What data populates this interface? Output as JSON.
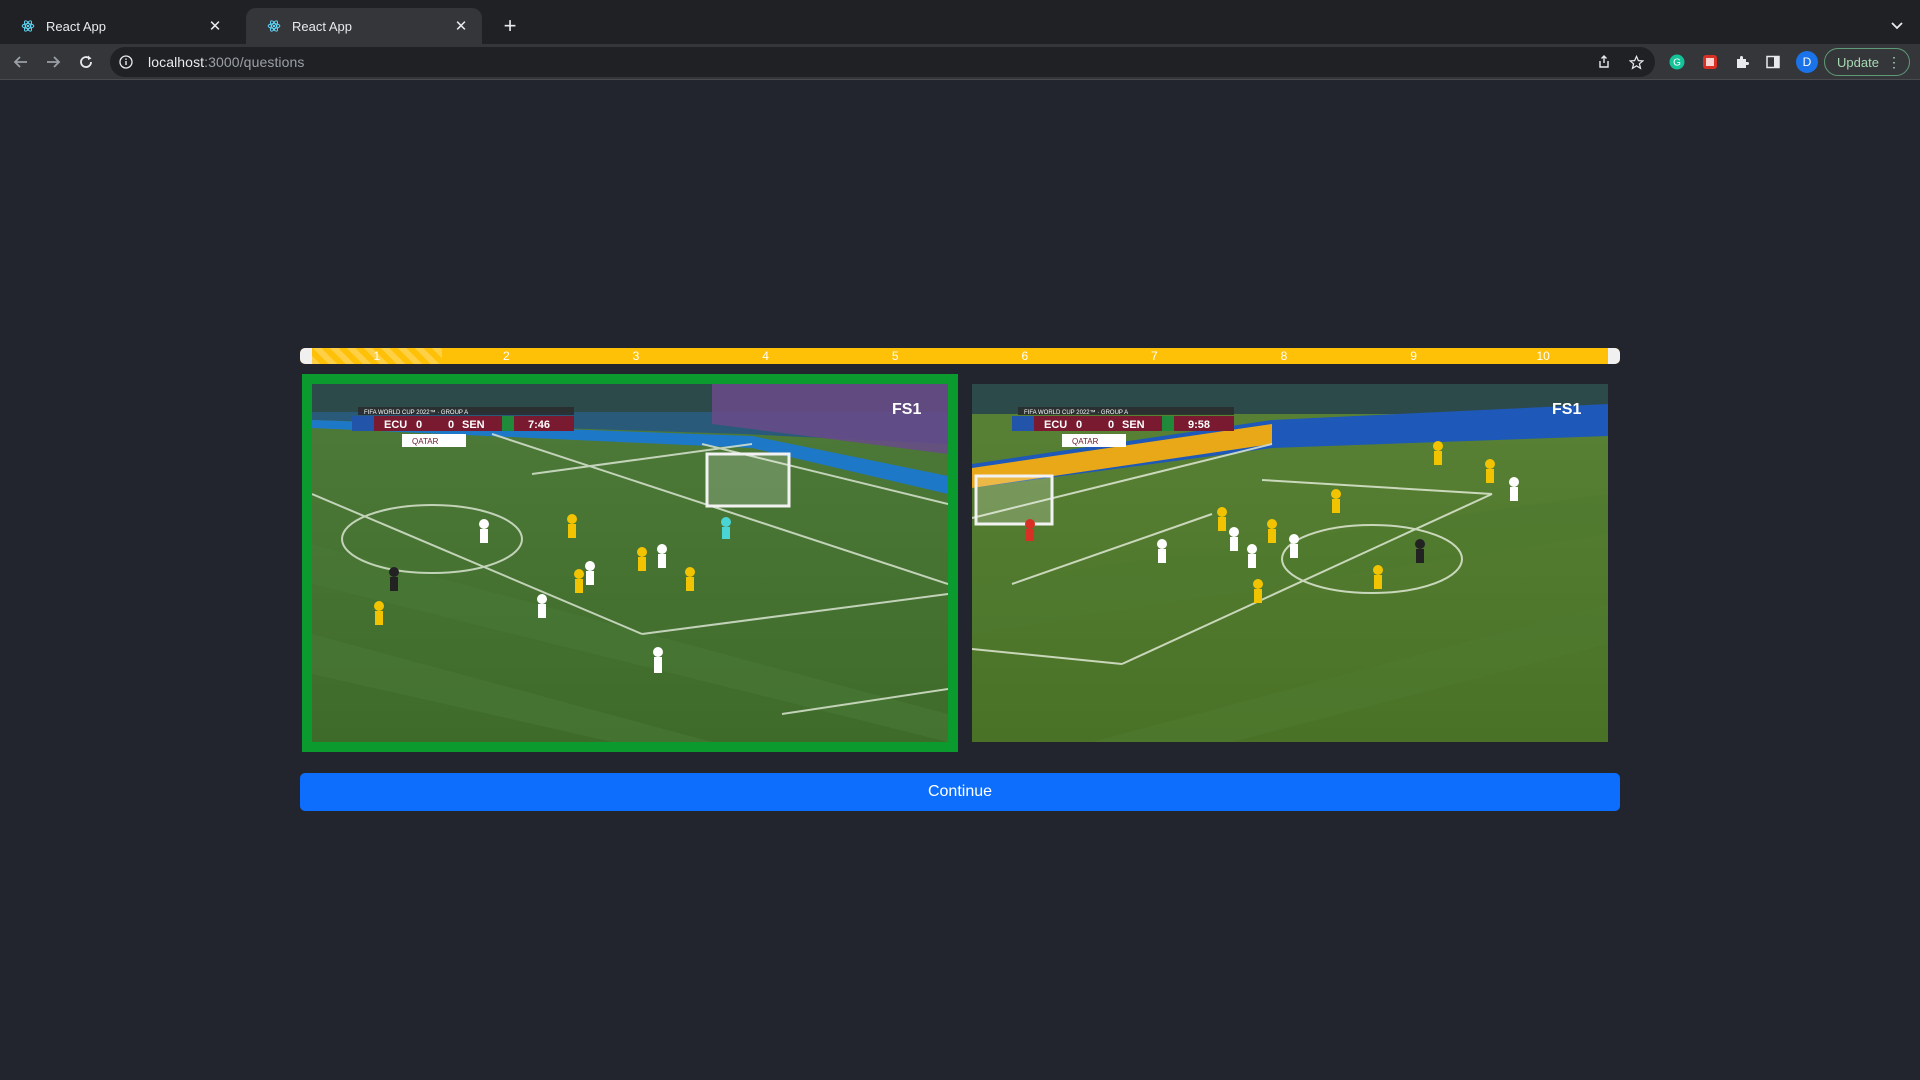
{
  "browser": {
    "tabs": [
      {
        "title": "React App",
        "active": false,
        "favicon": "react-icon"
      },
      {
        "title": "React App",
        "active": true,
        "favicon": "react-icon"
      }
    ],
    "url_host": "localhost",
    "url_path": ":3000/questions",
    "update_label": "Update",
    "profile_initial": "D"
  },
  "quiz": {
    "progress": {
      "fraction_complete": 0.1,
      "ticks": [
        "1",
        "2",
        "3",
        "4",
        "5",
        "6",
        "7",
        "8",
        "9",
        "10"
      ]
    },
    "choices": [
      {
        "selected": true,
        "scoreboard": {
          "team1": "ECU",
          "score1": "0",
          "team2": "SEN",
          "score2": "0",
          "time": "7:46",
          "tournament": "FIFA WORLD CUP 2022™ · GROUP A"
        },
        "broadcaster": "FS1",
        "sponsor": "QATAR"
      },
      {
        "selected": false,
        "scoreboard": {
          "team1": "ECU",
          "score1": "0",
          "team2": "SEN",
          "score2": "0",
          "time": "9:58",
          "tournament": "FIFA WORLD CUP 2022™ · GROUP A"
        },
        "broadcaster": "FS1",
        "sponsor": "QATAR"
      }
    ],
    "continue_label": "Continue"
  },
  "colors": {
    "page_bg": "#22252e",
    "progress_bar": "#ffc107",
    "selected_border": "#0a9a2e",
    "button_primary": "#0d6efd"
  }
}
